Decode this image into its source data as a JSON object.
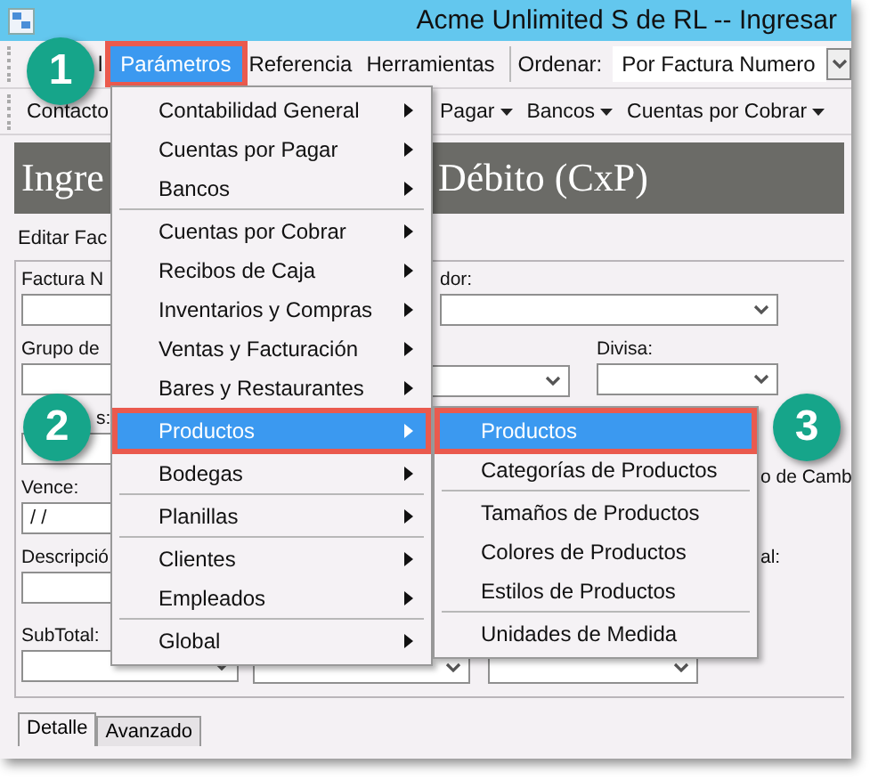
{
  "window": {
    "title": "Acme Unlimited S de RL -- Ingresar"
  },
  "menu_bar": {
    "items": [
      {
        "label": "l",
        "selected": false
      },
      {
        "label": "Parámetros",
        "selected": true
      },
      {
        "label": "Referencia",
        "selected": false
      },
      {
        "label": "Herramientas",
        "selected": false
      }
    ],
    "sort_label": "Ordenar:",
    "sort_value": "Por Factura Numero"
  },
  "toolbar": [
    {
      "label": "Contacto"
    },
    {
      "label": "Pagar",
      "dropdown": true
    },
    {
      "label": "Bancos",
      "dropdown": true
    },
    {
      "label": "Cuentas por Cobrar",
      "dropdown": true
    }
  ],
  "header": {
    "title_parts": [
      "Ingre",
      "Débito (CxP)"
    ]
  },
  "subtitle": "Editar Fac",
  "form": {
    "factura_label": "Factura N",
    "proveedor_label": "dor:",
    "grupo_label": "Grupo de",
    "divisa_label": "Divisa:",
    "row3_label": "s:",
    "vence_label": "Vence:",
    "vence_value": "/ /",
    "cambio_label": "o de Camb",
    "descripcion_label": "Descripció",
    "total_label": "al:",
    "subtotal_label": "SubTotal:"
  },
  "tabs": [
    {
      "label": "Detalle",
      "selected": true
    },
    {
      "label": "Avanzado",
      "selected": false
    }
  ],
  "menu": {
    "groups": [
      [
        {
          "label": "Contabilidad General",
          "selected": false
        },
        {
          "label": "Cuentas por Pagar",
          "selected": false
        },
        {
          "label": "Bancos",
          "selected": false
        }
      ],
      [
        {
          "label": "Cuentas por Cobrar",
          "selected": false
        },
        {
          "label": "Recibos de Caja",
          "selected": false
        },
        {
          "label": "Inventarios y Compras",
          "selected": false
        },
        {
          "label": "Ventas y Facturación",
          "selected": false
        },
        {
          "label": "Bares y Restaurantes",
          "selected": false
        }
      ],
      [
        {
          "label": "Productos",
          "selected": true
        }
      ],
      [
        {
          "label": "Bodegas",
          "selected": false
        }
      ],
      [
        {
          "label": "Planillas",
          "selected": false
        }
      ],
      [
        {
          "label": "Clientes",
          "selected": false
        },
        {
          "label": "Empleados",
          "selected": false
        }
      ],
      [
        {
          "label": "Global",
          "selected": false
        }
      ]
    ]
  },
  "submenu": {
    "groups": [
      [
        {
          "label": "Productos",
          "selected": true
        },
        {
          "label": "Categorías de Productos",
          "selected": false
        }
      ],
      [
        {
          "label": "Tamaños de Productos",
          "selected": false
        },
        {
          "label": "Colores de Productos",
          "selected": false
        },
        {
          "label": "Estilos de Productos",
          "selected": false
        }
      ],
      [
        {
          "label": "Unidades de Medida",
          "selected": false
        }
      ]
    ]
  },
  "badges": [
    "1",
    "2",
    "3"
  ]
}
